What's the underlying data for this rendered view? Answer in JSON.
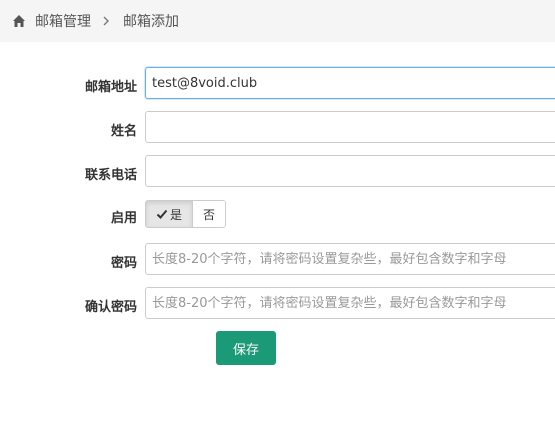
{
  "breadcrumb": {
    "home_icon": "home-icon",
    "items": [
      "邮箱管理",
      "邮箱添加"
    ]
  },
  "form": {
    "email": {
      "label": "邮箱地址",
      "value": "test@8void.club"
    },
    "name": {
      "label": "姓名",
      "value": ""
    },
    "phone": {
      "label": "联系电话",
      "value": ""
    },
    "enabled": {
      "label": "启用",
      "options": [
        "是",
        "否"
      ],
      "selected": "是"
    },
    "password": {
      "label": "密码",
      "placeholder": "长度8-20个字符，请将密码设置复杂些，最好包含数字和字母"
    },
    "confirm_password": {
      "label": "确认密码",
      "placeholder": "长度8-20个字符，请将密码设置复杂些，最好包含数字和字母"
    },
    "save_label": "保存"
  },
  "colors": {
    "accent": "#1a9a76",
    "focus_border": "#66afe9",
    "breadcrumb_bg": "#f5f5f5"
  }
}
